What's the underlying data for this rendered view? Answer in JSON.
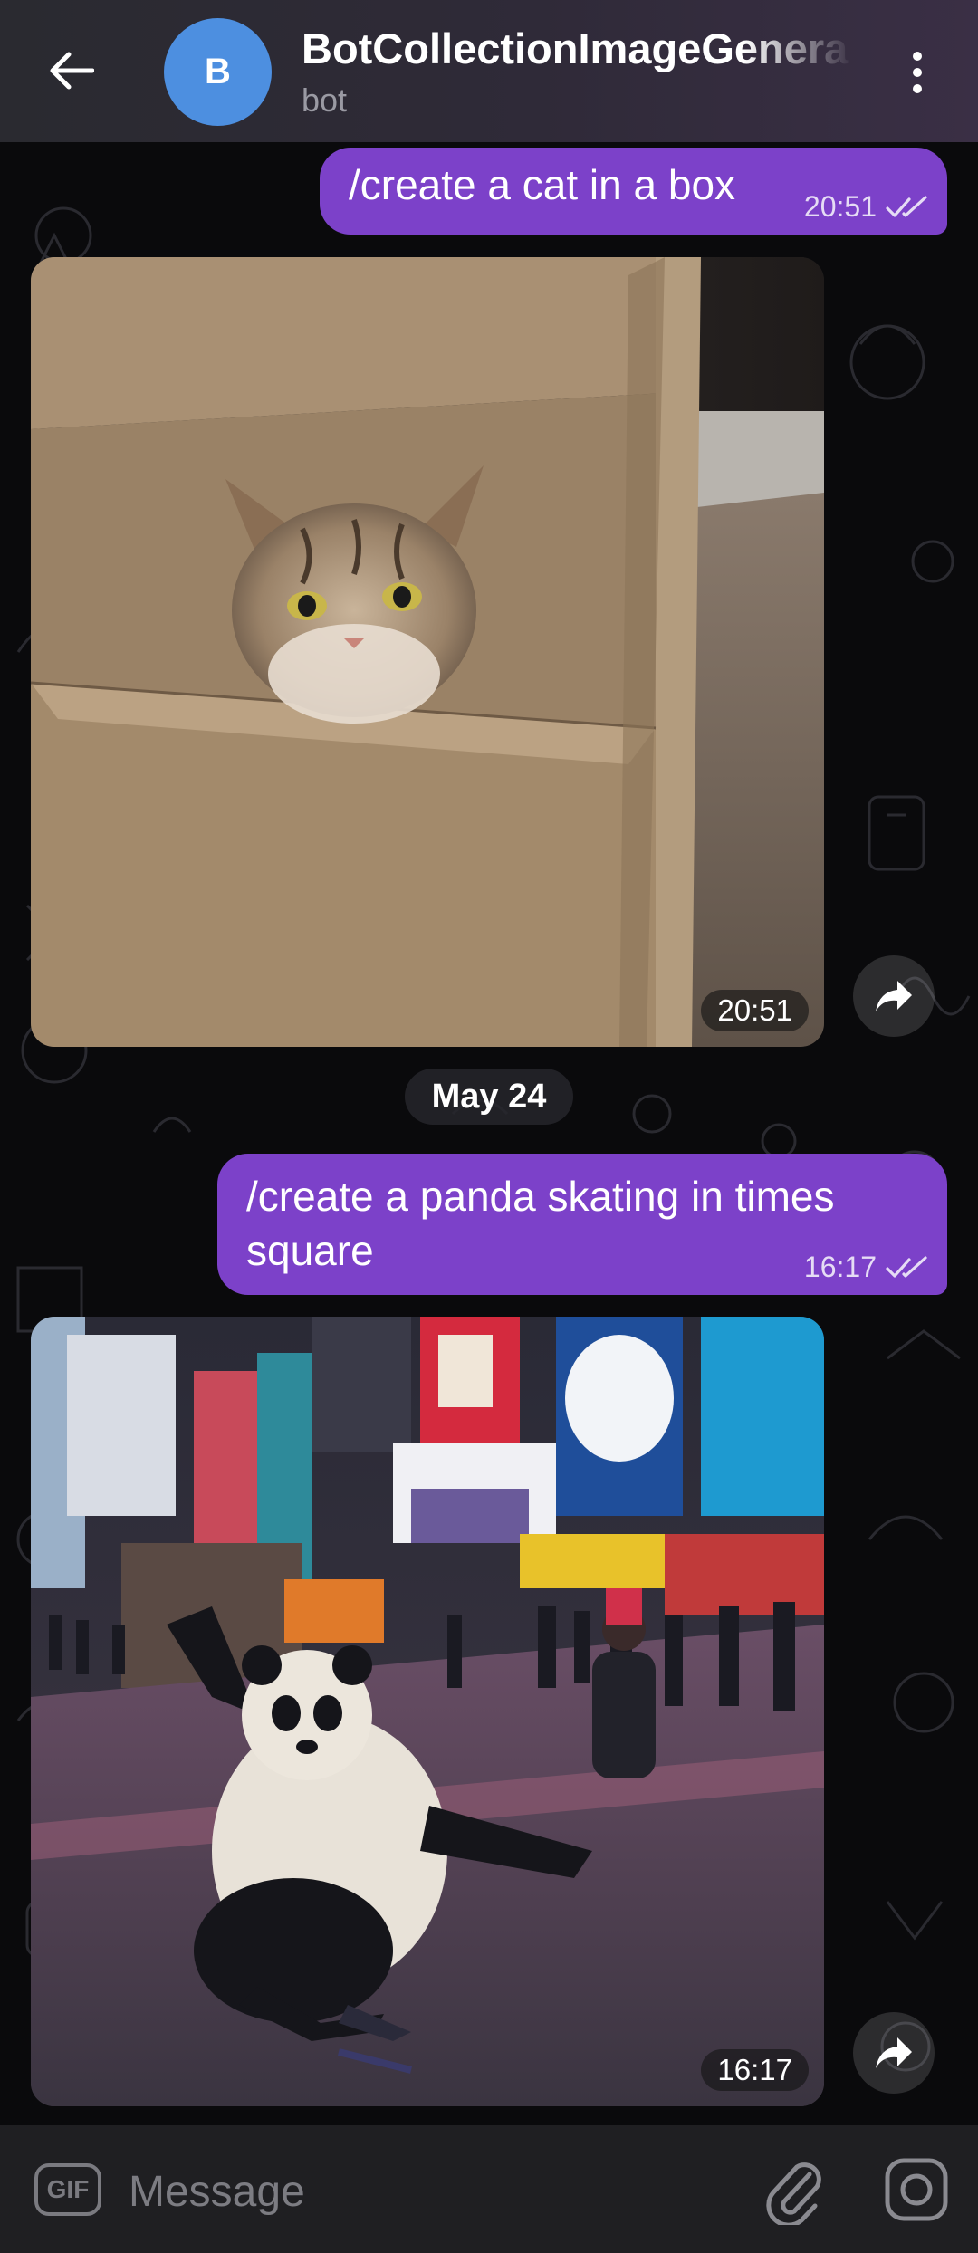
{
  "header": {
    "avatar_letter": "B",
    "title": "BotCollectionImageGenera",
    "subtitle": "bot"
  },
  "messages": [
    {
      "type": "outgoing-text",
      "text": "/create a cat in a box",
      "time": "20:51",
      "status": "read"
    },
    {
      "type": "incoming-photo",
      "subject": "cat in a box",
      "time": "20:51"
    },
    {
      "type": "date-separator",
      "text": "May 24"
    },
    {
      "type": "outgoing-text",
      "text": "/create a panda skating in times square",
      "line1": "/create a panda skating in times",
      "line2": "square",
      "time": "16:17",
      "status": "read"
    },
    {
      "type": "incoming-photo",
      "subject": "panda skating in times square",
      "time": "16:17"
    }
  ],
  "input": {
    "placeholder": "Message",
    "gif_label": "GIF"
  },
  "colors": {
    "header_bg": "#2d2b33",
    "outgoing_bubble": "#7c41c9",
    "avatar": "#4d8fe0",
    "chat_bg": "#0a0a0c",
    "input_bar": "#1f1f22"
  },
  "icons": [
    "back-arrow-icon",
    "more-vertical-icon",
    "double-check-icon",
    "share-icon",
    "gif-icon",
    "paperclip-icon",
    "camera-icon"
  ]
}
